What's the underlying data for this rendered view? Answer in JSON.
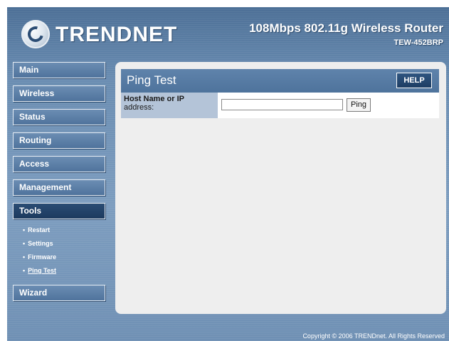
{
  "header": {
    "logo_text": "TRENDNET",
    "product_title": "108Mbps 802.11g Wireless Router",
    "model": "TEW-452BRP"
  },
  "sidebar": {
    "items": [
      {
        "label": "Main"
      },
      {
        "label": "Wireless"
      },
      {
        "label": "Status"
      },
      {
        "label": "Routing"
      },
      {
        "label": "Access"
      },
      {
        "label": "Management"
      },
      {
        "label": "Tools",
        "active": true
      }
    ],
    "tools_sub": [
      {
        "label": "Restart"
      },
      {
        "label": "Settings"
      },
      {
        "label": "Firmware"
      },
      {
        "label": "Ping Test",
        "current": true
      }
    ],
    "wizard": {
      "label": "Wizard"
    }
  },
  "panel": {
    "title": "Ping Test",
    "help_label": "HELP",
    "host_label_line1": "Host Name or IP",
    "host_label_line2": "address:",
    "host_value": "",
    "ping_label": "Ping"
  },
  "footer": {
    "copyright": "Copyright © 2006 TRENDnet. All Rights Reserved"
  },
  "colors": {
    "frame_blue": "#5a7fa6",
    "active_nav": "#1c3a5e",
    "label_cell": "#b4c4d8"
  }
}
